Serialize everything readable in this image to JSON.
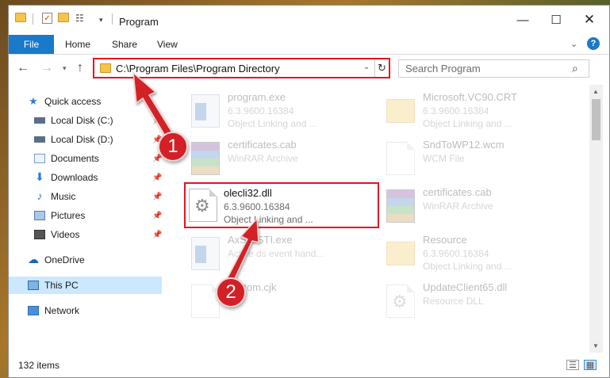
{
  "window": {
    "title": "Program",
    "controls": {
      "minimize": "—",
      "maximize": "☐",
      "close": "✕"
    }
  },
  "ribbon": {
    "tabs": [
      "File",
      "Home",
      "Share",
      "View"
    ],
    "help": "?"
  },
  "address": {
    "path": "C:\\Program Files\\Program Directory"
  },
  "search": {
    "placeholder": "Search Program"
  },
  "sidebar": {
    "items": [
      {
        "label": "Quick access",
        "icon": "star-icon"
      },
      {
        "label": "Local Disk (C:)",
        "icon": "drive-icon",
        "pinned": true
      },
      {
        "label": "Local Disk (D:)",
        "icon": "drive-icon",
        "pinned": true
      },
      {
        "label": "Documents",
        "icon": "documents-icon",
        "pinned": true
      },
      {
        "label": "Downloads",
        "icon": "download-icon",
        "pinned": true
      },
      {
        "label": "Music",
        "icon": "music-icon",
        "pinned": true
      },
      {
        "label": "Pictures",
        "icon": "pictures-icon",
        "pinned": true
      },
      {
        "label": "Videos",
        "icon": "videos-icon",
        "pinned": true
      },
      {
        "label": "OneDrive",
        "icon": "cloud-icon"
      },
      {
        "label": "This PC",
        "icon": "computer-icon",
        "selected": true
      },
      {
        "label": "Network",
        "icon": "network-icon"
      }
    ]
  },
  "files": [
    {
      "name": "program.exe",
      "version": "6.3.9600.16384",
      "type": "Object Linking and ...",
      "icon": "exe-icon",
      "faded": true
    },
    {
      "name": "Microsoft.VC90.CRT",
      "version": "6.3.9600.16384",
      "type": "Object Linking and ...",
      "icon": "folder-icon",
      "faded": true
    },
    {
      "name": "certificates.cab",
      "version": "",
      "type": "WinRAR Archive",
      "icon": "archive-icon",
      "faded": true
    },
    {
      "name": "SndToWP12.wcm",
      "version": "",
      "type": "WCM File",
      "icon": "document-icon",
      "faded": true
    },
    {
      "name": "olecli32.dll",
      "version": "6.3.9600.16384",
      "type": "Object Linking and ...",
      "icon": "dll-gear-icon",
      "faded": false
    },
    {
      "name": "certificates.cab",
      "version": "",
      "type": "WinRAR Archive",
      "icon": "archive-icon",
      "faded": true
    },
    {
      "name": "AxSysSTI.exe",
      "version": "",
      "type": "Active ds event hand...",
      "icon": "exe-icon",
      "faded": true
    },
    {
      "name": "Resource",
      "version": "6.3.9600.16384",
      "type": "Object Linking and ...",
      "icon": "folder-icon",
      "faded": true
    },
    {
      "name": "custom.cjk",
      "version": "",
      "type": "",
      "icon": "document-icon",
      "faded": true
    },
    {
      "name": "UpdateClient65.dll",
      "version": "",
      "type": "Resource DLL",
      "icon": "dll-gear-icon",
      "faded": true
    }
  ],
  "status": {
    "count": "132 items"
  },
  "annotations": {
    "callout_1": "1",
    "callout_2": "2",
    "color": "#d32027"
  }
}
